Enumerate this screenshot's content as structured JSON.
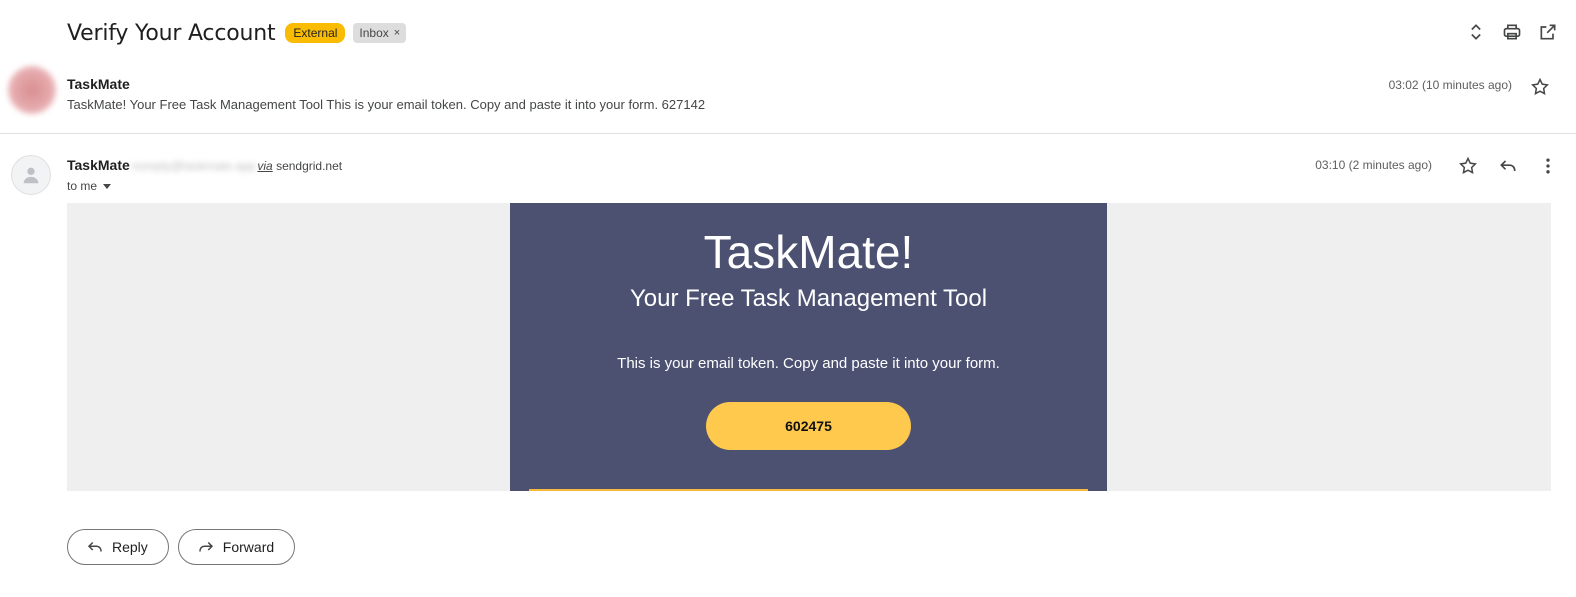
{
  "thread": {
    "subject": "Verify Your Account",
    "labels": {
      "external": "External",
      "inbox": "Inbox",
      "inbox_remove": "×"
    }
  },
  "collapsed_message": {
    "sender": "TaskMate",
    "snippet": "TaskMate! Your Free Task Management Tool This is your email token. Copy and paste it into your form. 627142",
    "time": "03:02 (10 minutes ago)"
  },
  "expanded_message": {
    "sender": "TaskMate",
    "sender_email": "noreply@taskmate.app",
    "via_label": "via",
    "via_domain": "sendgrid.net",
    "to": "to me",
    "time": "03:10 (2 minutes ago)"
  },
  "email_content": {
    "title": "TaskMate!",
    "subtitle": "Your Free Task Management Tool",
    "instruction": "This is your email token. Copy and paste it into your form.",
    "token": "602475"
  },
  "actions": {
    "reply": "Reply",
    "forward": "Forward"
  },
  "colors": {
    "card_bg": "#4c5172",
    "token_bg": "#fec94d",
    "external_badge": "#f9bc02",
    "body_bg": "#efefef"
  }
}
